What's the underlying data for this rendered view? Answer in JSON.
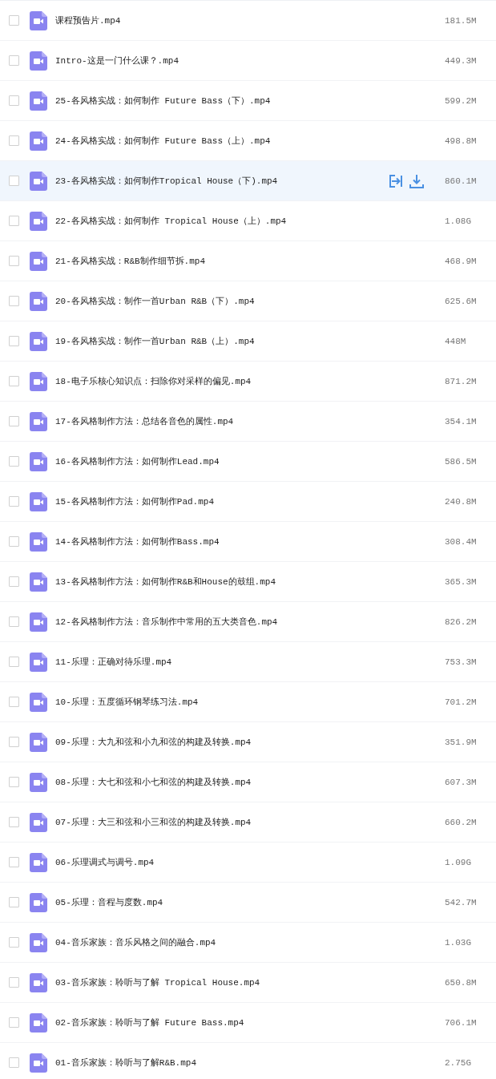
{
  "files": [
    {
      "name": "课程预告片.mp4",
      "size": "181.5M",
      "checked": false,
      "hovered": false
    },
    {
      "name": "Intro-这是一门什么课？.mp4",
      "size": "449.3M",
      "checked": false,
      "hovered": false
    },
    {
      "name": "25-各风格实战：如何制作 Future Bass（下）.mp4",
      "size": "599.2M",
      "checked": false,
      "hovered": false
    },
    {
      "name": "24-各风格实战：如何制作 Future Bass（上）.mp4",
      "size": "498.8M",
      "checked": false,
      "hovered": false
    },
    {
      "name": "23-各风格实战：如何制作Tropical House（下).mp4",
      "size": "860.1M",
      "checked": false,
      "hovered": true
    },
    {
      "name": "22-各风格实战：如何制作 Tropical House（上）.mp4",
      "size": "1.08G",
      "checked": false,
      "hovered": false
    },
    {
      "name": "21-各风格实战：R&B制作细节拆.mp4",
      "size": "468.9M",
      "checked": false,
      "hovered": false
    },
    {
      "name": "20-各风格实战：制作一首Urban R&B（下）.mp4",
      "size": "625.6M",
      "checked": false,
      "hovered": false
    },
    {
      "name": "19-各风格实战：制作一首Urban R&B（上）.mp4",
      "size": "448M",
      "checked": false,
      "hovered": false
    },
    {
      "name": "18-电子乐核心知识点：扫除你对采样的偏见.mp4",
      "size": "871.2M",
      "checked": false,
      "hovered": false
    },
    {
      "name": "17-各风格制作方法：总结各音色的属性.mp4",
      "size": "354.1M",
      "checked": false,
      "hovered": false
    },
    {
      "name": "16-各风格制作方法：如何制作Lead.mp4",
      "size": "586.5M",
      "checked": false,
      "hovered": false
    },
    {
      "name": "15-各风格制作方法：如何制作Pad.mp4",
      "size": "240.8M",
      "checked": false,
      "hovered": false
    },
    {
      "name": "14-各风格制作方法：如何制作Bass.mp4",
      "size": "308.4M",
      "checked": false,
      "hovered": false
    },
    {
      "name": "13-各风格制作方法：如何制作R&B和House的鼓组.mp4",
      "size": "365.3M",
      "checked": false,
      "hovered": false
    },
    {
      "name": "12-各风格制作方法：音乐制作中常用的五大类音色.mp4",
      "size": "826.2M",
      "checked": false,
      "hovered": false
    },
    {
      "name": "11-乐理：正确对待乐理.mp4",
      "size": "753.3M",
      "checked": false,
      "hovered": false
    },
    {
      "name": "10-乐理：五度循环钢琴练习法.mp4",
      "size": "701.2M",
      "checked": false,
      "hovered": false
    },
    {
      "name": "09-乐理：大九和弦和小九和弦的构建及转换.mp4",
      "size": "351.9M",
      "checked": false,
      "hovered": false
    },
    {
      "name": "08-乐理：大七和弦和小七和弦的构建及转换.mp4",
      "size": "607.3M",
      "checked": false,
      "hovered": false
    },
    {
      "name": "07-乐理：大三和弦和小三和弦的构建及转换.mp4",
      "size": "660.2M",
      "checked": false,
      "hovered": false
    },
    {
      "name": "06-乐理调式与调号.mp4",
      "size": "1.09G",
      "checked": false,
      "hovered": false
    },
    {
      "name": "05-乐理：音程与度数.mp4",
      "size": "542.7M",
      "checked": false,
      "hovered": false
    },
    {
      "name": "04-音乐家族：音乐风格之间的融合.mp4",
      "size": "1.03G",
      "checked": false,
      "hovered": false
    },
    {
      "name": "03-音乐家族：聆听与了解 Tropical House.mp4",
      "size": "650.8M",
      "checked": false,
      "hovered": false
    },
    {
      "name": "02-音乐家族：聆听与了解 Future Bass.mp4",
      "size": "706.1M",
      "checked": false,
      "hovered": false
    },
    {
      "name": "01-音乐家族：聆听与了解R&B.mp4",
      "size": "2.75G",
      "checked": false,
      "hovered": false
    }
  ]
}
